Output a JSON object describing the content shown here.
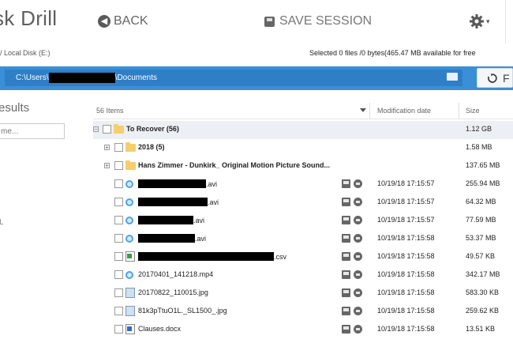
{
  "header": {
    "app_title": "sk Drill",
    "back_label": "BACK",
    "save_label": "SAVE SESSION"
  },
  "infobar": {
    "breadcrumb": "/ Local Disk (E:)",
    "selected_info": "Selected 0 files /0 bytes(465.47 MB available for free"
  },
  "pathbar": {
    "path_prefix": "C:\\Users\\",
    "path_suffix": "\\Documents",
    "scan_label": "F"
  },
  "left_panel": {
    "heading": "esults",
    "filter_placeholder": "me..."
  },
  "columns": {
    "items_count": "56 Items",
    "modification_date": "Modification date",
    "size": "Size"
  },
  "rows": [
    {
      "name": "To Recover (56)",
      "date": "",
      "size": "1.12 GB"
    },
    {
      "name": "2018 (5)",
      "date": "",
      "size": "1.58 MB"
    },
    {
      "name": "Hans Zimmer - Dunkirk_ Original Motion Picture Sound...",
      "date": "",
      "size": "137.65 MB"
    },
    {
      "name": ".avi",
      "date": "10/19/18 17:15:57",
      "size": "255.94 MB"
    },
    {
      "name": ".avi",
      "date": "10/19/18 17:15:57",
      "size": "64.32 MB"
    },
    {
      "name": ".avi",
      "date": "10/19/18 17:15:57",
      "size": "77.59 MB"
    },
    {
      "name": ".avi",
      "date": "10/19/18 17:15:58",
      "size": "53.37 MB"
    },
    {
      "name": ".csv",
      "date": "10/19/18 17:15:58",
      "size": "49.57 KB"
    },
    {
      "name": "20170401_141218.mp4",
      "date": "10/19/18 17:15:58",
      "size": "342.17 MB"
    },
    {
      "name": "20170822_110015.jpg",
      "date": "10/19/18 17:15:58",
      "size": "583.30 KB"
    },
    {
      "name": "81k3pTtuO1L._SL1500_.jpg",
      "date": "10/19/18 17:15:58",
      "size": "259.62 KB"
    },
    {
      "name": "Clauses.docx",
      "date": "10/19/18 17:15:58",
      "size": "13.51 KB"
    }
  ],
  "colors": {
    "path_bar": "#3a8fd6",
    "folder": "#f5cf6c",
    "selected_row": "#eceff3"
  },
  "icons": [
    "back-arrow-icon",
    "save-disk-icon",
    "gear-icon",
    "folder-open-icon",
    "refresh-icon",
    "folder-icon",
    "video-file-icon",
    "csv-file-icon",
    "image-file-icon",
    "word-file-icon",
    "preview-icon",
    "recover-icon"
  ]
}
